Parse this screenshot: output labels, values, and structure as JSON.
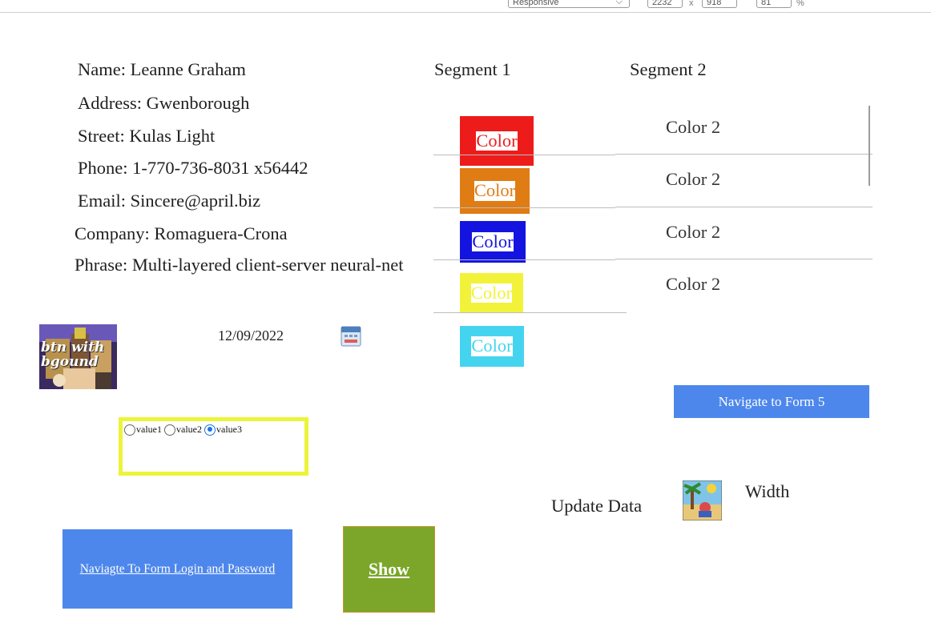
{
  "devtools": {
    "mode": "Responsive",
    "width": "2232",
    "separator": "x",
    "height": "918",
    "zoom": "81",
    "percent": "%"
  },
  "person": {
    "name": "Name: Leanne Graham",
    "address": "Address: Gwenborough",
    "street": "Street: Kulas Light",
    "phone": "Phone: 1-770-736-8031 x56442",
    "email": "Email: Sincere@april.biz",
    "company": "Company: Romaguera-Crona",
    "phrase": "Phrase: Multi-layered client-server neural-net"
  },
  "segment1": {
    "title": "Segment 1",
    "swatches": [
      {
        "label": "Color",
        "bg": "#ee1b1b",
        "text": "#ee1b1b"
      },
      {
        "label": "Color",
        "bg": "#e07c14",
        "text": "#e07c14"
      },
      {
        "label": "Color",
        "bg": "#1414e0",
        "text": "#1414e0"
      },
      {
        "label": "Color",
        "bg": "#f3f23a",
        "text": "#f3f23a"
      },
      {
        "label": "Color",
        "bg": "#45d4ef",
        "text": "#45d4ef"
      }
    ]
  },
  "segment2": {
    "title": "Segment 2",
    "items": [
      "Color 2",
      "Color 2",
      "Color 2",
      "Color 2"
    ]
  },
  "thumb": {
    "caption_line1": "btn with",
    "caption_line2": "bgound"
  },
  "date": {
    "value": "12/09/2022",
    "icon": "calendar-icon"
  },
  "navigate5": {
    "label": "Navigate to Form 5"
  },
  "radios": {
    "options": [
      "value1",
      "value2",
      "value3"
    ],
    "selected": "value3"
  },
  "update_data": {
    "label": "Update Data",
    "icon": "beach-picture-icon"
  },
  "width_label": "Width",
  "login_button": {
    "label": "Naviagte To Form Login and Password"
  },
  "show_button": {
    "label": "Show"
  },
  "colors": {
    "button_blue": "#4d87ec",
    "show_green": "#7ba62a",
    "radio_border": "#ecf43a"
  }
}
